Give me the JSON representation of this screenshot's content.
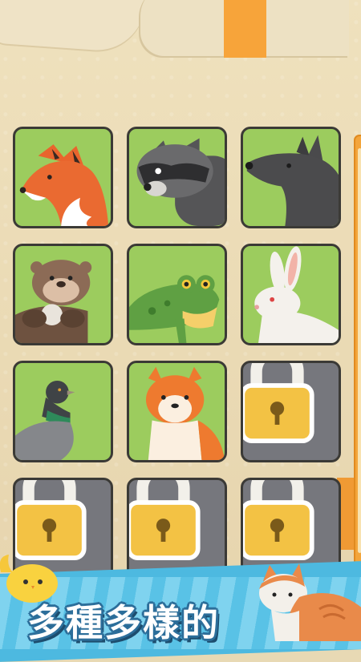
{
  "banner": {
    "text": "多種多樣的"
  },
  "collection": {
    "cards": [
      {
        "animal": "fox",
        "locked": false
      },
      {
        "animal": "raccoon",
        "locked": false
      },
      {
        "animal": "wolf",
        "locked": false
      },
      {
        "animal": "otter",
        "locked": false
      },
      {
        "animal": "frog",
        "locked": false
      },
      {
        "animal": "rabbit",
        "locked": false
      },
      {
        "animal": "pigeon",
        "locked": false
      },
      {
        "animal": "shiba-inu",
        "locked": false
      },
      {
        "animal": "",
        "locked": true
      },
      {
        "animal": "",
        "locked": true
      },
      {
        "animal": "",
        "locked": true
      },
      {
        "animal": "",
        "locked": true
      }
    ]
  },
  "colors": {
    "unlocked_bg": "#9ccc5e",
    "locked_bg": "#76777d",
    "accent_orange": "#f7a43a",
    "banner_blue": "#4db9e0"
  },
  "icons": {
    "lock": "padlock-icon"
  }
}
